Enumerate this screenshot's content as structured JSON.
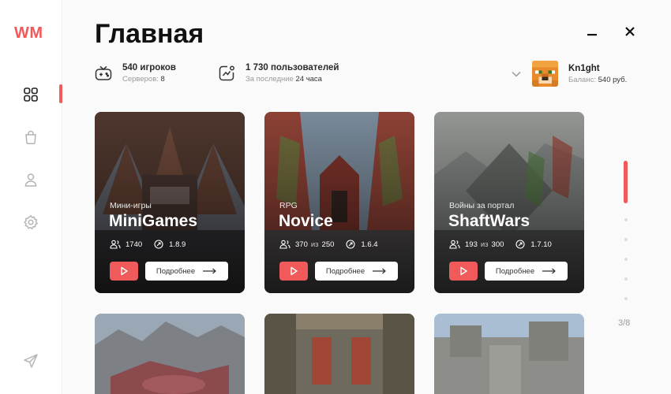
{
  "app": {
    "logo": "WM"
  },
  "header": {
    "title": "Главная"
  },
  "window": {
    "minimize_icon": "minimize-icon",
    "close_icon": "close-icon"
  },
  "stats": {
    "players": {
      "main": "540 игроков",
      "sub_label": "Серверов:",
      "sub_value": "8"
    },
    "users": {
      "main": "1 730 пользователей",
      "sub_label": "За последние",
      "sub_value": "24 часа"
    }
  },
  "user": {
    "name": "Kn1ght",
    "balance_label": "Баланс:",
    "balance_value": "540 руб."
  },
  "sidebar": {
    "items": [
      {
        "icon": "grid-icon",
        "active": true
      },
      {
        "icon": "shopping-bag-icon",
        "active": false
      },
      {
        "icon": "user-icon",
        "active": false
      },
      {
        "icon": "gear-icon",
        "active": false
      }
    ],
    "bottom_icon": "send-icon"
  },
  "servers": [
    {
      "genre": "Мини-игры",
      "name": "MiniGames",
      "players": "1740",
      "players_max": "",
      "version": "1.8.9",
      "more_label": "Подробнее",
      "accent": "#8a4a3a"
    },
    {
      "genre": "RPG",
      "name": "Novice",
      "players": "370",
      "players_sep": "из",
      "players_max": "250",
      "version": "1.6.4",
      "more_label": "Подробнее",
      "accent": "#a24636"
    },
    {
      "genre": "Войны за портал",
      "name": "ShaftWars",
      "players": "193",
      "players_sep": "из",
      "players_max": "300",
      "version": "1.7.10",
      "more_label": "Подробнее",
      "accent": "#7d8a7a"
    }
  ],
  "pagination": {
    "text": "3/8",
    "current": 3,
    "total": 8
  },
  "colors": {
    "accent": "#f05a5a"
  }
}
